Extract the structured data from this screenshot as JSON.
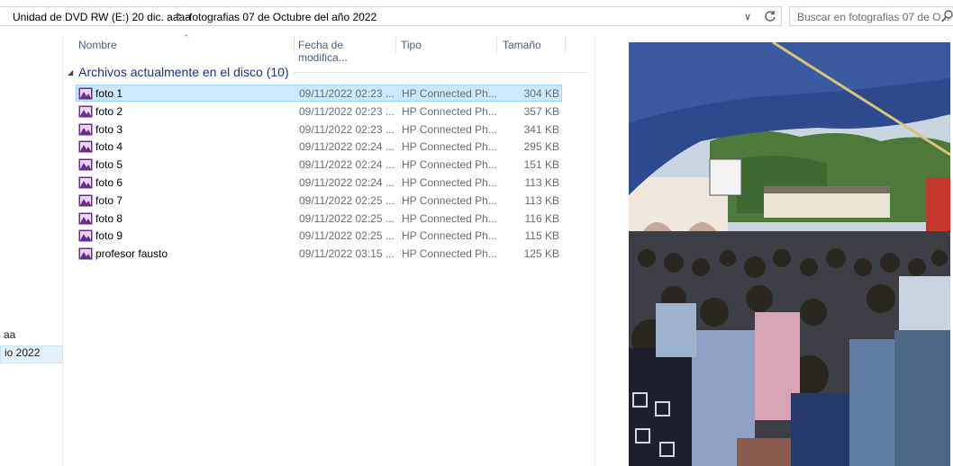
{
  "address_bar": {
    "crumbs": [
      "Unidad de DVD RW (E:) 20 dic. aaaa",
      "fotografias 07 de Octubre del año 2022"
    ],
    "search_placeholder": "Buscar en fotografias 07 de O..."
  },
  "nav_pane": {
    "items": [
      "aa",
      "io 2022"
    ]
  },
  "columns": {
    "name": "Nombre",
    "date": "Fecha de modifica...",
    "type": "Tipo",
    "size": "Tamaño"
  },
  "group": {
    "label": "Archivos actualmente en el disco (10)"
  },
  "files": [
    {
      "name": "foto 1",
      "date": "09/11/2022 02:23 ...",
      "type": "HP Connected Ph...",
      "size": "304 KB",
      "selected": true
    },
    {
      "name": "foto 2",
      "date": "09/11/2022 02:23 ...",
      "type": "HP Connected Ph...",
      "size": "357 KB"
    },
    {
      "name": "foto 3",
      "date": "09/11/2022 02:23 ...",
      "type": "HP Connected Ph...",
      "size": "341 KB"
    },
    {
      "name": "foto 4",
      "date": "09/11/2022 02:24 ...",
      "type": "HP Connected Ph...",
      "size": "295 KB"
    },
    {
      "name": "foto 5",
      "date": "09/11/2022 02:24 ...",
      "type": "HP Connected Ph...",
      "size": "151 KB"
    },
    {
      "name": "foto 6",
      "date": "09/11/2022 02:24 ...",
      "type": "HP Connected Ph...",
      "size": "113 KB"
    },
    {
      "name": "foto 7",
      "date": "09/11/2022 02:25 ...",
      "type": "HP Connected Ph...",
      "size": "113 KB"
    },
    {
      "name": "foto 8",
      "date": "09/11/2022 02:25 ...",
      "type": "HP Connected Ph...",
      "size": "116 KB"
    },
    {
      "name": "foto 9",
      "date": "09/11/2022 02:25 ...",
      "type": "HP Connected Ph...",
      "size": "115 KB"
    },
    {
      "name": "profesor fausto",
      "date": "09/11/2022 03:15 ...",
      "type": "HP Connected Ph...",
      "size": "125 KB"
    }
  ],
  "colors": {
    "selection_bg": "#cce8ff",
    "selection_border": "#99d1ff",
    "group_header": "#1e3287",
    "file_icon": "#6b2d8c"
  },
  "icons": {
    "file": "image-file-icon",
    "search": "search-icon",
    "refresh": "refresh-icon",
    "dropdown": "chevron-down-icon"
  }
}
